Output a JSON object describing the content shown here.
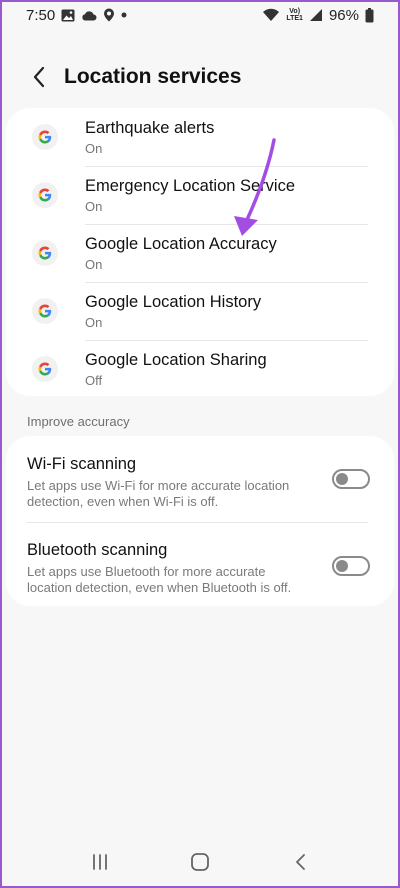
{
  "status_bar": {
    "time": "7:50",
    "lte_line1": "Vo)",
    "lte_line2": "LTE1",
    "battery": "96%"
  },
  "header": {
    "title": "Location services"
  },
  "apps": [
    {
      "title": "Earthquake alerts",
      "status": "On",
      "icon": "google-g-icon"
    },
    {
      "title": "Emergency Location Service",
      "status": "On",
      "icon": "google-g-icon"
    },
    {
      "title": "Google Location Accuracy",
      "status": "On",
      "icon": "google-g-icon"
    },
    {
      "title": "Google Location History",
      "status": "On",
      "icon": "google-g-icon"
    },
    {
      "title": "Google Location Sharing",
      "status": "Off",
      "icon": "google-g-icon"
    }
  ],
  "improve_accuracy": {
    "label": "Improve accuracy",
    "items": [
      {
        "title": "Wi-Fi scanning",
        "description": "Let apps use Wi-Fi for more accurate location detection, even when Wi-Fi is off.",
        "enabled": false
      },
      {
        "title": "Bluetooth scanning",
        "description": "Let apps use Bluetooth for more accurate location detection, even when Bluetooth is off.",
        "enabled": false
      }
    ]
  },
  "colors": {
    "background": "#f7f7f7",
    "card": "#ffffff",
    "annotation_arrow": "#a44de3",
    "frame_border": "#9b59d0"
  }
}
